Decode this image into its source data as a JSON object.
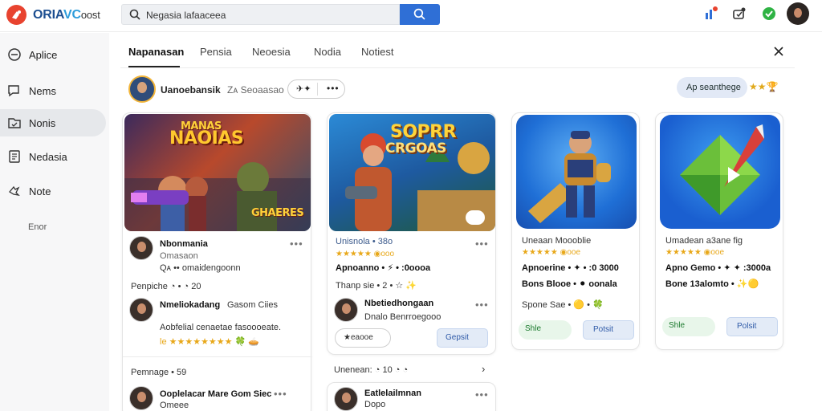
{
  "header": {
    "logo": {
      "part_a": "ORIA",
      "part_b": "VC",
      "part_c": "oost"
    },
    "search": {
      "value": "Negasia lafaaceea",
      "icon": "search-icon"
    },
    "search_button_icon": "search-icon",
    "icons": [
      "chart-icon",
      "notification-icon",
      "online-status-icon",
      "user-avatar"
    ],
    "accent_color": "#2f6fd6"
  },
  "sidebar": {
    "items": [
      {
        "label": "Aplice",
        "icon": "compass-icon"
      },
      {
        "label": "Nems",
        "icon": "chat-icon"
      },
      {
        "label": "Nonis",
        "icon": "folder-icon"
      },
      {
        "label": "Nedasia",
        "icon": "document-icon"
      },
      {
        "label": "Note",
        "icon": "puzzle-icon"
      }
    ],
    "footer": "Enor"
  },
  "tabs": {
    "items": [
      "Napanasan",
      "Pensia",
      "Neoesia",
      "Nodia",
      "Notiest"
    ]
  },
  "channel": {
    "name": "Uanoebansik",
    "sub": "Zᴀ Seoaasao",
    "pill_left": "✈✦",
    "pill_right": "•••",
    "filter_pill": "Ap seanthege",
    "filter_stars": "★★🏆"
  },
  "cards": [
    {
      "thumb_title": "NAOIAS",
      "thumb_title_top": "MANAS",
      "thumb_sub": "GHAERES",
      "title": "Nbonmania",
      "line1": "Omasaon",
      "line2": "Qᴀ •• omaidengoonn",
      "section": "Penpiche ◔ • ◔ 20",
      "comment_author": "Nmeliokadang",
      "comment_meta": "Gasom Ciies",
      "comment_text": "Aobfelial cenaetae fasoooeate.",
      "comment_stars": "le ★★★★★★★★ 🍀 🥧",
      "footer": "Pemnage • 59",
      "footer_author": "Ooplelacar Mare Gom Siec",
      "footer_sub": "Omeee"
    },
    {
      "thumb_title": "SOPRR",
      "thumb_title_top": "",
      "thumb_sub": "CRGOAS",
      "title": "Unisnola • 38o",
      "stars": "★★★★★ ◉ooo",
      "line1": "Apnoanno • ⚡ • :0oooa",
      "line2": "Thanp sie • 2 • ☆ ✨",
      "comment_author": "Nbetiedhongaan",
      "comment_meta": "Dnalo Benrroegooo",
      "btn_outline": "★eaooe",
      "btn_blue": "Gepsit",
      "footer": "Unenean: ◔ 10 ◔ ◔",
      "footer_author": "Eatlelailmnan",
      "footer_sub": "Dopo"
    },
    {
      "title": "Uneaan Moooblie",
      "stars": "★★★★★ ◉ooe",
      "line1": "Apnoerine • ✦ • :0 3000",
      "line2": "Bons Blooe • ⚫ oonala",
      "line3": "Spone Sae • 🟡 • 🍀",
      "btn_green": "Shle",
      "btn_blue": "Potsit"
    },
    {
      "title": "Umadean a3ane fig",
      "stars": "★★★★★ ◉ooe",
      "line1": "Apno Gemo • ✦ ✦ :3000a",
      "line2": "Bone 13alomto • ✨🟡",
      "btn_green": "Shle",
      "btn_blue": "Polsit"
    }
  ]
}
